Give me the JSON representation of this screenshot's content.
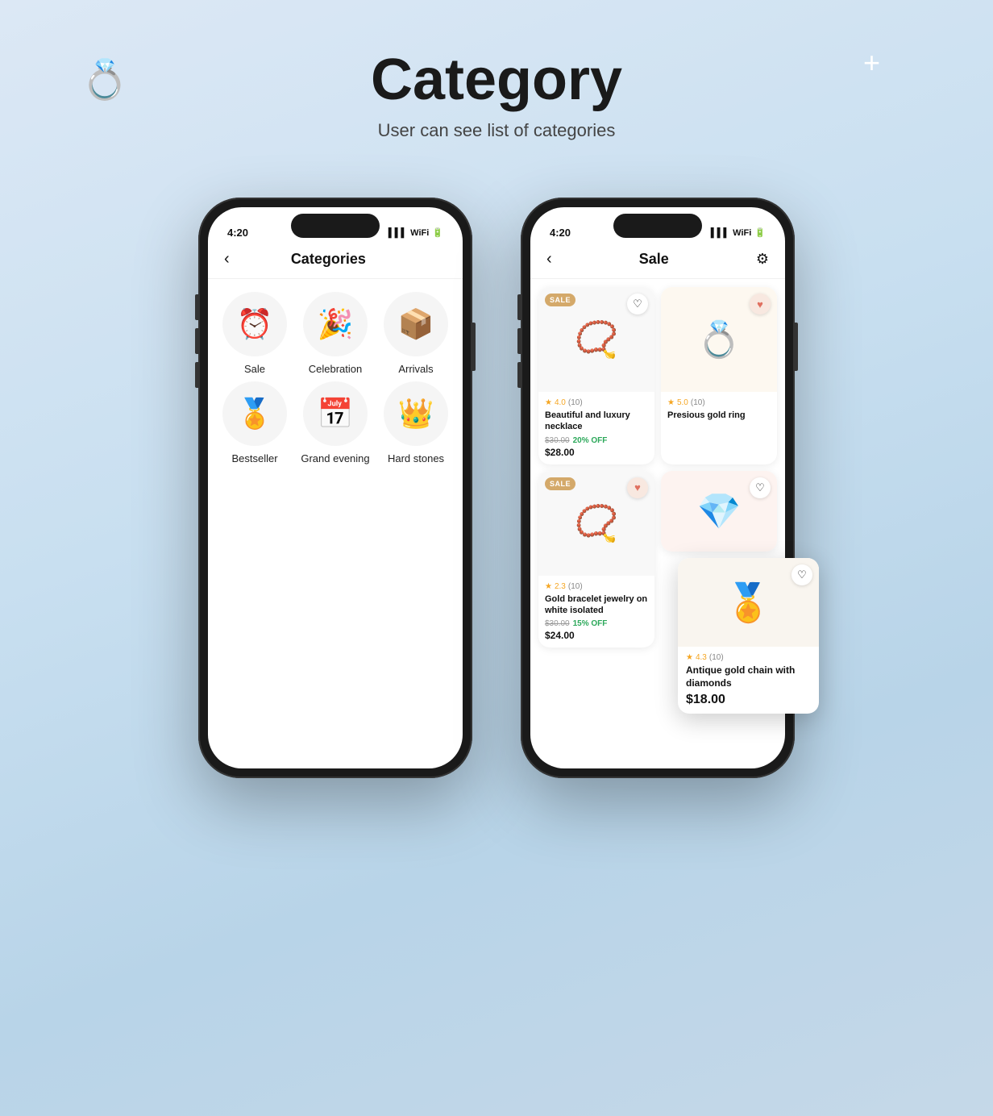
{
  "page": {
    "title": "Category",
    "subtitle": "User can see list of categories",
    "deco_ring": "💍",
    "deco_plus": "+"
  },
  "phone1": {
    "time": "4:20",
    "nav": {
      "back": "‹",
      "title": "Categories"
    },
    "categories": [
      {
        "id": "sale",
        "icon": "⏰",
        "label": "Sale"
      },
      {
        "id": "celebration",
        "icon": "🎉",
        "label": "Celebration"
      },
      {
        "id": "arrivals",
        "icon": "📦",
        "label": "Arrivals"
      },
      {
        "id": "bestseller",
        "icon": "🏅",
        "label": "Bestseller"
      },
      {
        "id": "grand-evening",
        "icon": "📅",
        "label": "Grand evening"
      },
      {
        "id": "hard-stones",
        "icon": "👑",
        "label": "Hard stones"
      }
    ]
  },
  "phone2": {
    "time": "4:20",
    "nav": {
      "back": "‹",
      "title": "Sale",
      "filter": "⚙"
    },
    "products": [
      {
        "id": "p1",
        "sale_badge": "SALE",
        "heart": "♡",
        "heart_filled": false,
        "icon": "📿",
        "rating": "4.0",
        "rating_count": "(10)",
        "name": "Beautiful and luxury necklace",
        "price_original": "$30.00",
        "discount": "20% OFF",
        "price_current": "$28.00"
      },
      {
        "id": "p2",
        "sale_badge": null,
        "heart": "♥",
        "heart_filled": true,
        "icon": "💍",
        "rating": "5.0",
        "rating_count": "(10)",
        "name": "Presious gold ring",
        "price_original": null,
        "discount": null,
        "price_current": null
      },
      {
        "id": "p3",
        "sale_badge": "SALE",
        "heart": "♥",
        "heart_filled": true,
        "icon": "📿",
        "rating": "2.3",
        "rating_count": "(10)",
        "name": "Gold bracelet jewelry on white isolated",
        "price_original": "$30.00",
        "discount": "15% OFF",
        "price_current": "$24.00"
      },
      {
        "id": "p4-partial",
        "icon": "💎",
        "partial": true
      }
    ],
    "floating_card": {
      "icon": "🏅",
      "heart": "♡",
      "rating": "4.3",
      "rating_count": "(10)",
      "name": "Antique gold chain with diamonds",
      "price": "$18.00"
    }
  }
}
